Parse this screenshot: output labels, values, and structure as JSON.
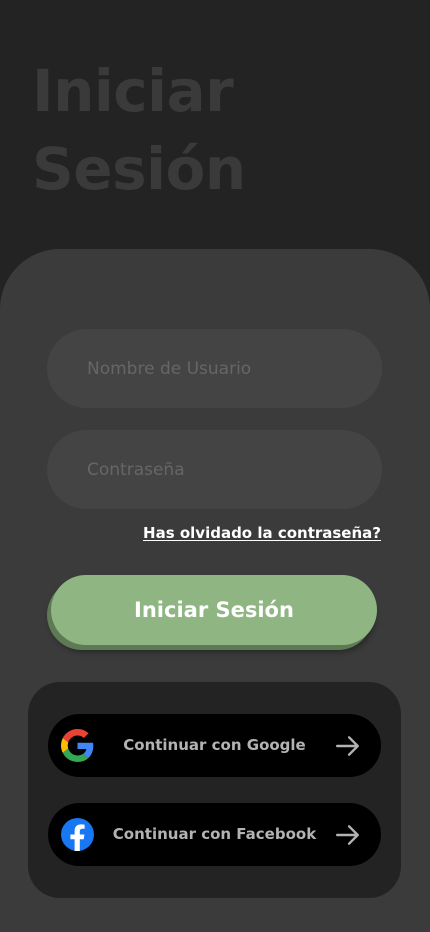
{
  "header": {
    "title": "Iniciar Sesión"
  },
  "form": {
    "username_placeholder": "Nombre de Usuario",
    "username_value": "",
    "password_placeholder": "Contraseña",
    "password_value": "",
    "forgot_password_label": "Has olvidado la contraseña?",
    "login_button_label": "Iniciar Sesión"
  },
  "social": {
    "google": {
      "label": "Continuar con Google",
      "icon": "google-icon"
    },
    "facebook": {
      "label": "Continuar con Facebook",
      "icon": "facebook-icon"
    },
    "arrow_icon": "arrow-right-icon"
  },
  "colors": {
    "background": "#232323",
    "card": "#3b3b3b",
    "input": "#444444",
    "accent": "#8fb682",
    "social_panel": "#232323",
    "social_button": "#000000",
    "facebook_blue": "#1877f2"
  }
}
